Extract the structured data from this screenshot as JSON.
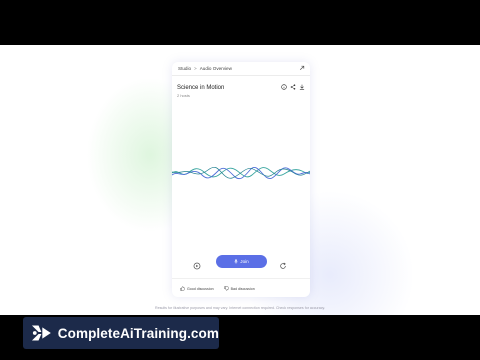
{
  "breadcrumb": {
    "root": "Studio",
    "separator": ">",
    "current": "Audio Overview"
  },
  "overview": {
    "title": "Science in Motion",
    "subtitle": "2 hosts"
  },
  "player": {
    "join_label": "Join"
  },
  "feedback": {
    "good_label": "Good discussion",
    "bad_label": "Bad discussion"
  },
  "disclaimer": "Results for illustrative purposes and may vary. Internet connection required. Check responses for accuracy.",
  "banner": {
    "brand": "CompleteAiTraining.com"
  },
  "colors": {
    "accent": "#5b6fe6",
    "wave_teal": "#3aa6a0",
    "wave_blue": "#4f6fd8",
    "banner_bg": "#1c2a4a"
  },
  "icons": [
    "collapse-icon",
    "info-icon",
    "share-icon",
    "download-icon",
    "rewind-icon",
    "refresh-icon",
    "thumbs-up-icon",
    "thumbs-down-icon",
    "brand-logo"
  ]
}
